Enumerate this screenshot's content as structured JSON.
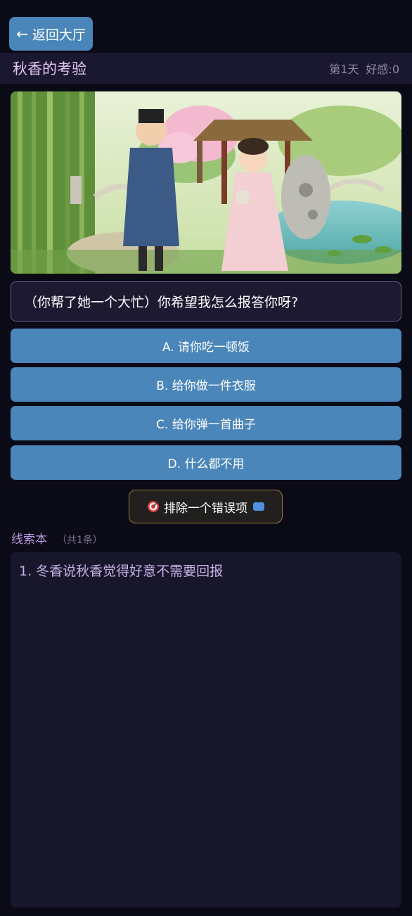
{
  "nav": {
    "back_arrow": "←",
    "back_label": "返回大厅"
  },
  "header": {
    "title": "秋香的考验",
    "day": "第1天",
    "affection": "好感:0"
  },
  "scene": {
    "image_desc_icon": "garden-scene-illustration"
  },
  "question": {
    "text": "（你帮了她一个大忙）你希望我怎么报答你呀?"
  },
  "options": [
    {
      "label": "A. 请你吃一顿饭"
    },
    {
      "label": "B. 给你做一件衣服"
    },
    {
      "label": "C. 给你弹一首曲子"
    },
    {
      "label": "D. 什么都不用"
    }
  ],
  "hint": {
    "label": "排除一个错误项",
    "icon": "target-icon",
    "badge_icon": "video-ad-icon"
  },
  "clues": {
    "title": "线索本",
    "count": "（共1条）",
    "items": [
      {
        "text": "1. 冬香说秋香觉得好意不需要回报"
      }
    ]
  },
  "colors": {
    "background": "#0b0a17",
    "button": "#4a86b9",
    "header_bar": "#1a1730",
    "title": "#e3c6ee",
    "clue_text": "#c8b4e8",
    "hint_border": "#9a7c3c"
  }
}
